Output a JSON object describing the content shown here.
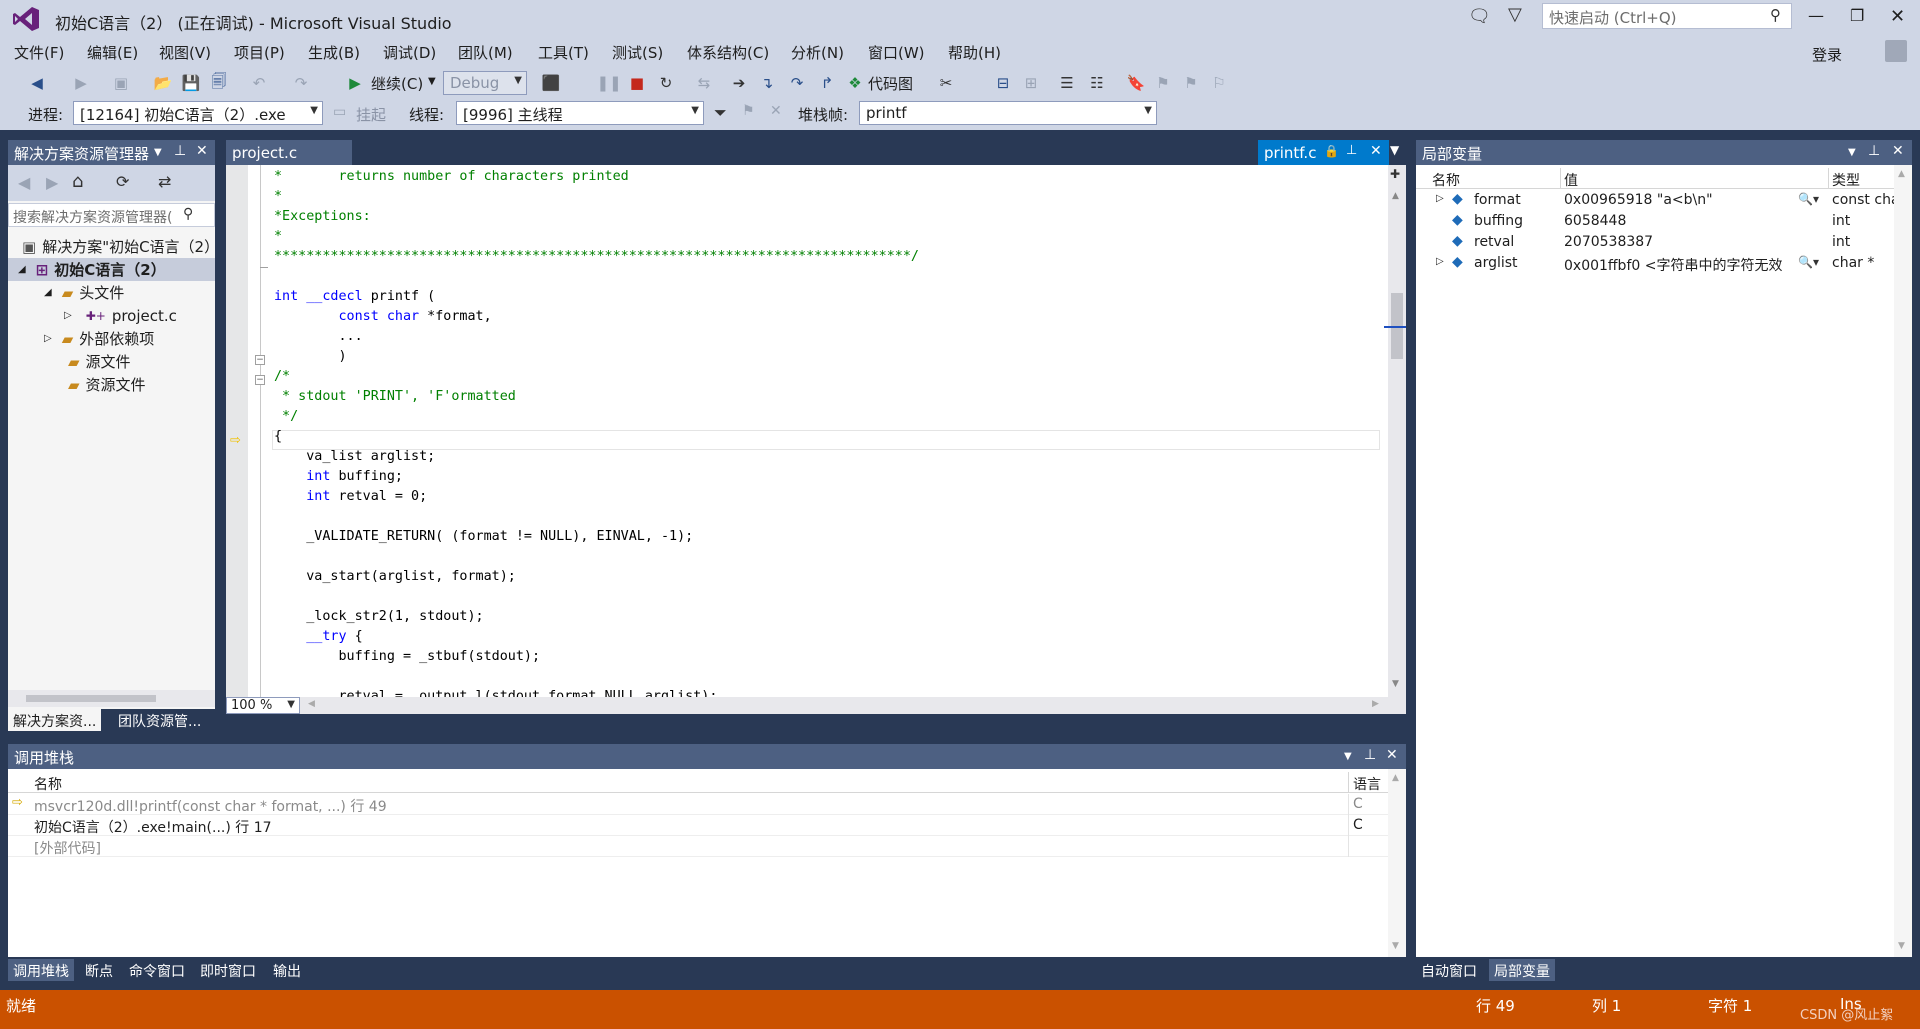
{
  "window": {
    "title": "初始C语言（2） (正在调试) - Microsoft Visual Studio",
    "quick_launch_placeholder": "快速启动 (Ctrl+Q)",
    "login": "登录"
  },
  "menu": [
    "文件(F)",
    "编辑(E)",
    "视图(V)",
    "项目(P)",
    "生成(B)",
    "调试(D)",
    "团队(M)",
    "工具(T)",
    "测试(S)",
    "体系结构(C)",
    "分析(N)",
    "窗口(W)",
    "帮助(H)"
  ],
  "toolbar": {
    "continue_label": "继续(C)",
    "config": "Debug",
    "codemap_label": "代码图"
  },
  "debugbar": {
    "process_label": "进程:",
    "process_value": "[12164] 初始C语言（2）.exe",
    "suspend_label": "挂起",
    "thread_label": "线程:",
    "thread_value": "[9996] 主线程",
    "stackframe_label": "堆栈帧:",
    "stackframe_value": "printf"
  },
  "solution_explorer": {
    "title": "解决方案资源管理器",
    "search_placeholder": "搜索解决方案资源管理器(",
    "solution": "解决方案\"初始C语言（2）",
    "project": "初始C语言（2）",
    "items": [
      "头文件",
      "project.c",
      "外部依赖项",
      "源文件",
      "资源文件"
    ],
    "tabs": [
      "解决方案资...",
      "团队资源管..."
    ]
  },
  "editor": {
    "tab_left": "project.c",
    "tab_active": "printf.c",
    "zoom": "100 %",
    "lines": [
      [
        [
          "cm",
          "*       returns number of characters printed"
        ]
      ],
      [
        [
          "cm",
          "*"
        ]
      ],
      [
        [
          "cm",
          "*Exceptions:"
        ]
      ],
      [
        [
          "cm",
          "*"
        ]
      ],
      [
        [
          "cm",
          "*******************************************************************************/"
        ]
      ],
      [
        [
          "",
          ""
        ]
      ],
      [
        [
          "kw",
          "int"
        ],
        [
          "",
          " "
        ],
        [
          "kw",
          "__cdecl"
        ],
        [
          "",
          " printf ("
        ]
      ],
      [
        [
          "",
          "        "
        ],
        [
          "kw",
          "const"
        ],
        [
          "",
          " "
        ],
        [
          "kw",
          "char"
        ],
        [
          "",
          " *format,"
        ]
      ],
      [
        [
          "",
          "        ..."
        ]
      ],
      [
        [
          "",
          "        )"
        ]
      ],
      [
        [
          "cm",
          "/*"
        ]
      ],
      [
        [
          "cm",
          " * stdout 'PRINT', 'F'ormatted"
        ]
      ],
      [
        [
          "cm",
          " */"
        ]
      ],
      [
        [
          "",
          "{"
        ]
      ],
      [
        [
          "",
          "    va_list arglist;"
        ]
      ],
      [
        [
          "",
          "    "
        ],
        [
          "kw",
          "int"
        ],
        [
          "",
          " buffing;"
        ]
      ],
      [
        [
          "",
          "    "
        ],
        [
          "kw",
          "int"
        ],
        [
          "",
          " retval = 0;"
        ]
      ],
      [
        [
          "",
          ""
        ]
      ],
      [
        [
          "",
          "    _VALIDATE_RETURN( (format != NULL), EINVAL, -1);"
        ]
      ],
      [
        [
          "",
          ""
        ]
      ],
      [
        [
          "",
          "    va_start(arglist, format);"
        ]
      ],
      [
        [
          "",
          ""
        ]
      ],
      [
        [
          "",
          "    _lock_str2(1, stdout);"
        ]
      ],
      [
        [
          "",
          "    "
        ],
        [
          "kw",
          "__try"
        ],
        [
          "",
          " {"
        ]
      ],
      [
        [
          "",
          "        buffing = _stbuf(stdout);"
        ]
      ],
      [
        [
          "",
          ""
        ]
      ],
      [
        [
          "",
          "        retval = _output_l(stdout,format,NULL,arglist);"
        ]
      ]
    ]
  },
  "locals": {
    "title": "局部变量",
    "headers": [
      "名称",
      "值",
      "类型"
    ],
    "rows": [
      {
        "name": "format",
        "value": "0x00965918 \"a<b\\n\"",
        "type": "const cha",
        "expandable": true
      },
      {
        "name": "buffing",
        "value": "6058448",
        "type": "int",
        "expandable": false
      },
      {
        "name": "retval",
        "value": "2070538387",
        "type": "int",
        "expandable": false
      },
      {
        "name": "arglist",
        "value": "0x001ffbf0  <字符串中的字符无效",
        "type": "char *",
        "expandable": true
      }
    ],
    "tabs": [
      "自动窗口",
      "局部变量"
    ]
  },
  "callstack": {
    "title": "调用堆栈",
    "headers": [
      "名称",
      "语言"
    ],
    "rows": [
      {
        "name": "msvcr120d.dll!printf(const char * format, ...) 行 49",
        "lang": "C"
      },
      {
        "name": "初始C语言（2）.exe!main(...) 行 17",
        "lang": "C"
      },
      {
        "name": "[外部代码]",
        "lang": ""
      }
    ],
    "tabs": [
      "调用堆栈",
      "断点",
      "命令窗口",
      "即时窗口",
      "输出"
    ]
  },
  "status": {
    "ready": "就绪",
    "line": "行 49",
    "col": "列 1",
    "char": "字符 1",
    "ins": "Ins",
    "watermark": "CSDN @风止絮"
  },
  "colors": {
    "accent": "#ca5100",
    "chrome": "#cfd6e5",
    "pane_header": "#4d6082",
    "active_tab": "#007acc"
  }
}
